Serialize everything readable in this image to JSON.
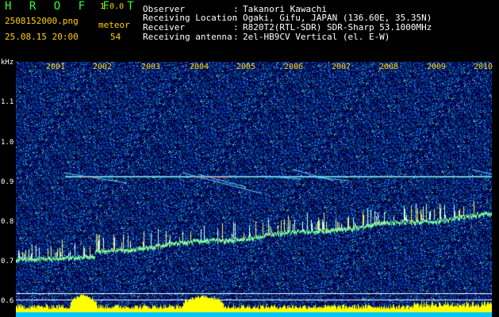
{
  "header": {
    "app_name": "H R O F F T",
    "version": "1.0.0",
    "filename": "2508152000.png",
    "timestamp": "25.08.15 20:00",
    "meteor_label": "meteor",
    "meteor_count": "54",
    "info": [
      {
        "key": "Observer",
        "sep": ":",
        "value": "Takanori Kawachi"
      },
      {
        "key": "Receiving Location",
        "sep": ":",
        "value": "Ogaki, Gifu, JAPAN (136.60E, 35.35N)"
      },
      {
        "key": "Receiver",
        "sep": ":",
        "value": "R820T2(RTL-SDR) SDR-Sharp 53.1000MHz"
      },
      {
        "key": "Receiving antenna",
        "sep": ":",
        "value": "2el-HB9CV Vertical (el. E-W)"
      }
    ]
  },
  "axis": {
    "y_unit": "kHz",
    "y_ticks": [
      "1.1",
      "1.0",
      "0.9",
      "0.8",
      "0.7",
      "0.6"
    ],
    "x_ticks": [
      "2001",
      "2002",
      "2003",
      "2004",
      "2005",
      "2006",
      "2007",
      "2008",
      "2009",
      "2010"
    ]
  },
  "colors": {
    "background": "#000000",
    "noise": "#0a1a6e",
    "trace": "#7cffa0",
    "carrier": "#88ffee",
    "level": "#ffff00",
    "level_base": "#00c8ff",
    "label": "#ffd200"
  }
}
